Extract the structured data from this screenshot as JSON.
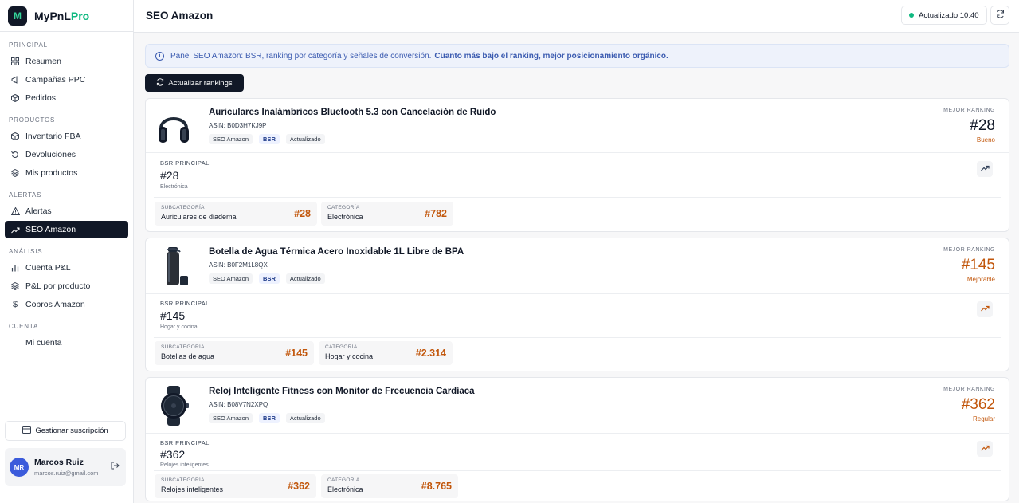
{
  "app": {
    "brand_main": "MyPnL",
    "brand_pro": "Pro",
    "logo_glyph": "M"
  },
  "sidebar": {
    "sections": [
      {
        "label": "PRINCIPAL",
        "items": [
          {
            "label": "Resumen",
            "icon": "grid-icon"
          },
          {
            "label": "Campañas PPC",
            "icon": "megaphone-icon"
          },
          {
            "label": "Pedidos",
            "icon": "package-icon"
          }
        ]
      },
      {
        "label": "PRODUCTOS",
        "items": [
          {
            "label": "Inventario FBA",
            "icon": "box-icon"
          },
          {
            "label": "Devoluciones",
            "icon": "undo-icon"
          },
          {
            "label": "Mis productos",
            "icon": "layers-icon"
          }
        ]
      },
      {
        "label": "ALERTAS",
        "items": [
          {
            "label": "Alertas",
            "icon": "warning-icon"
          },
          {
            "label": "SEO Amazon",
            "icon": "trending-up-icon",
            "active": true
          }
        ]
      },
      {
        "label": "ANÁLISIS",
        "items": [
          {
            "label": "Cuenta P&L",
            "icon": "bar-chart-icon"
          },
          {
            "label": "P&L por producto",
            "icon": "layers-icon"
          },
          {
            "label": "Cobros Amazon",
            "icon": "dollar-icon"
          }
        ]
      },
      {
        "label": "CUENTA",
        "items": [
          {
            "label": "Mi cuenta",
            "icon": ""
          }
        ]
      }
    ],
    "manage_subscription": "Gestionar suscripción",
    "user": {
      "initials": "MR",
      "name": "Marcos Ruiz",
      "email": "marcos.ruiz@gmail.com"
    }
  },
  "header": {
    "title": "SEO Amazon",
    "updated": "Actualizado 10:40"
  },
  "banner": {
    "text": "Panel SEO Amazon: BSR, ranking por categoría y señales de conversión.",
    "strong": "Cuanto más bajo el ranking, mejor posicionamiento orgánico."
  },
  "update_button": "Actualizar rankings",
  "labels": {
    "best_ranking": "MEJOR RANKING",
    "bsr_principal": "BSR PRINCIPAL",
    "subcategory": "SUBCATEGORÍA",
    "category": "CATEGORÍA",
    "tag_seo": "SEO Amazon",
    "tag_bsr": "BSR",
    "tag_updated": "Actualizado"
  },
  "colors": {
    "good": "#c2570c",
    "improvable": "#c2570c",
    "regular": "#c2570c"
  },
  "products": [
    {
      "title": "Auriculares Inalámbricos Bluetooth 5.3 con Cancelación de Ruido",
      "asin": "ASIN: B0D3H7KJ9P",
      "best_rank": "#28",
      "status": "Bueno",
      "bsr": "#28",
      "bsr_category": "Electrónica",
      "sub_name": "Auriculares de diadema",
      "sub_rank": "#28",
      "cat_name": "Electrónica",
      "cat_rank": "#782",
      "image": "headphones"
    },
    {
      "title": "Botella de Agua Térmica Acero Inoxidable 1L Libre de BPA",
      "asin": "ASIN: B0F2M1L8QX",
      "best_rank": "#145",
      "status": "Mejorable",
      "bsr": "#145",
      "bsr_category": "Hogar y cocina",
      "sub_name": "Botellas de agua",
      "sub_rank": "#145",
      "cat_name": "Hogar y cocina",
      "cat_rank": "#2.314",
      "image": "bottle"
    },
    {
      "title": "Reloj Inteligente Fitness con Monitor de Frecuencia Cardíaca",
      "asin": "ASIN: B08V7N2XPQ",
      "best_rank": "#362",
      "status": "Regular",
      "bsr": "#362",
      "bsr_category": "Relojes inteligentes",
      "sub_name": "Relojes inteligentes",
      "sub_rank": "#362",
      "cat_name": "Electrónica",
      "cat_rank": "#8.765",
      "image": "smartwatch"
    }
  ]
}
